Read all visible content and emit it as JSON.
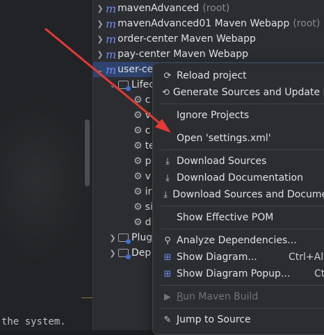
{
  "editor": {
    "bottom_text": "the system."
  },
  "tree": {
    "rows": [
      {
        "name": "mavenAdvanced",
        "suffix": "(root)"
      },
      {
        "name": "mavenAdvanced01 Maven Webapp",
        "suffix": "(root)"
      },
      {
        "name": "order-center Maven Webapp",
        "suffix": ""
      },
      {
        "name": "pay-center Maven Webapp",
        "suffix": ""
      },
      {
        "name": "user-ce",
        "suffix": ""
      }
    ],
    "lifecycle": "Lifec",
    "lifecycle_children": [
      "c",
      "v",
      "c",
      "te",
      "p",
      "v",
      "ir",
      "si",
      "d"
    ],
    "plugins": "Plug",
    "dependencies": "Dep"
  },
  "context_menu": {
    "items": [
      {
        "label": "Reload project",
        "icon": "reload-icon"
      },
      {
        "label": "Generate Sources and Update Fo",
        "icon": "generate-sources-icon"
      },
      {
        "label": "Ignore Projects"
      },
      {
        "label": "Open 'settings.xml'"
      },
      {
        "label": "Download Sources",
        "icon": "download-icon"
      },
      {
        "label": "Download Documentation",
        "icon": "download-icon"
      },
      {
        "label": "Download Sources and Documen",
        "icon": "download-icon"
      },
      {
        "label": "Show Effective POM"
      },
      {
        "label": "Analyze Dependencies...",
        "icon": "analyze-icon"
      },
      {
        "label": "Show Diagram...",
        "icon": "diagram-icon",
        "shortcut": "Ctrl+Alt-"
      },
      {
        "label": "Show Diagram Popup...",
        "icon": "diagram-icon",
        "shortcut": "Ct"
      },
      {
        "label_pre": "",
        "label_ul": "R",
        "label_post": "un Maven Build",
        "icon": "run-icon",
        "disabled": true
      },
      {
        "label_pre": "",
        "label_ul": "J",
        "label_post": "ump to Source",
        "icon": "edit-icon"
      }
    ]
  },
  "colors": {
    "selected_row": "#2e436e",
    "maven_icon": "#6f8cf0",
    "arrow": "#e53935"
  }
}
